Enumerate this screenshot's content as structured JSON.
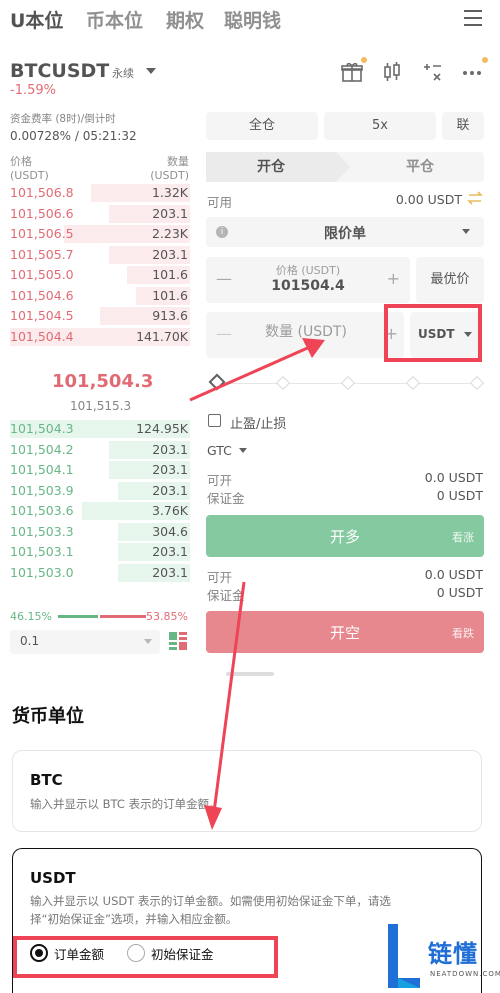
{
  "nav": {
    "tabs": [
      "U本位",
      "币本位",
      "期权",
      "聪明钱"
    ]
  },
  "header": {
    "symbol": "BTCUSDT",
    "contract_type": "永续",
    "change_pct": "-1.59%",
    "funding_label": "资金费率 (8时)/倒计时",
    "funding_value": "0.00728% / 05:21:32"
  },
  "orderbook": {
    "price_label": "价格",
    "price_unit": "(USDT)",
    "qty_label": "数量",
    "qty_unit": "(USDT)",
    "asks": [
      {
        "price": "101,506.8",
        "qty": "1.32K",
        "depth": 0.55
      },
      {
        "price": "101,506.6",
        "qty": "203.1",
        "depth": 0.45
      },
      {
        "price": "101,506.5",
        "qty": "2.23K",
        "depth": 0.7
      },
      {
        "price": "101,505.7",
        "qty": "203.1",
        "depth": 0.45
      },
      {
        "price": "101,505.0",
        "qty": "101.6",
        "depth": 0.35
      },
      {
        "price": "101,504.6",
        "qty": "101.6",
        "depth": 0.3
      },
      {
        "price": "101,504.5",
        "qty": "913.6",
        "depth": 0.5
      },
      {
        "price": "101,504.4",
        "qty": "141.70K",
        "depth": 1.0
      }
    ],
    "last_price": "101,504.3",
    "mark_price": "101,515.3",
    "bids": [
      {
        "price": "101,504.3",
        "qty": "124.95K",
        "depth": 1.0
      },
      {
        "price": "101,504.2",
        "qty": "203.1",
        "depth": 0.45
      },
      {
        "price": "101,504.1",
        "qty": "203.1",
        "depth": 0.45
      },
      {
        "price": "101,503.9",
        "qty": "203.1",
        "depth": 0.4
      },
      {
        "price": "101,503.6",
        "qty": "3.76K",
        "depth": 0.6
      },
      {
        "price": "101,503.3",
        "qty": "304.6",
        "depth": 0.4
      },
      {
        "price": "101,503.1",
        "qty": "203.1",
        "depth": 0.4
      },
      {
        "price": "101,503.0",
        "qty": "203.1",
        "depth": 0.4
      }
    ],
    "buy_ratio": "46.15%",
    "sell_ratio": "53.85%",
    "buy_fraction": 0.4615,
    "depth_step": "0.1"
  },
  "order_form": {
    "margin_mode": "全仓",
    "leverage": "5x",
    "third_btn": "联",
    "tab_open": "开仓",
    "tab_close": "平仓",
    "available_label": "可用",
    "available_value": "0.00 USDT",
    "order_type": "限价单",
    "price_label": "价格 (USDT)",
    "price_value": "101504.4",
    "best_price": "最优价",
    "qty_placeholder": "数量 (USDT)",
    "unit": "USDT",
    "tpsl_label": "止盈/止损",
    "tif": "GTC",
    "can_open_label": "可开",
    "can_open_value": "0.0 USDT",
    "margin_label": "保证金",
    "margin_value": "0 USDT",
    "long_label": "开多",
    "long_sub": "看涨",
    "short_can_open_label": "可开",
    "short_can_open_value": "0.0 USDT",
    "short_margin_label": "保证金",
    "short_margin_value": "0 USDT",
    "short_label": "开空",
    "short_sub": "看跌"
  },
  "sheet": {
    "title": "货币单位",
    "btc_title": "BTC",
    "btc_desc": "输入并显示以 BTC 表示的订单金额。",
    "usdt_title": "USDT",
    "usdt_desc_1": "输入并显示以 USDT 表示的订单金额。如需使用初始保证金下单，请选",
    "usdt_desc_2": "择“初始保证金”选项，并输入相应金额。",
    "radio_order_amount": "订单金额",
    "radio_initial_margin": "初始保证金"
  },
  "watermark": {
    "text": "链懂",
    "sub": "NEATDOWN.COM"
  },
  "colors": {
    "red": "#d6323f",
    "green": "#2d9b58",
    "annotation": "#ee4455",
    "watermark": "#1f6fd6"
  }
}
